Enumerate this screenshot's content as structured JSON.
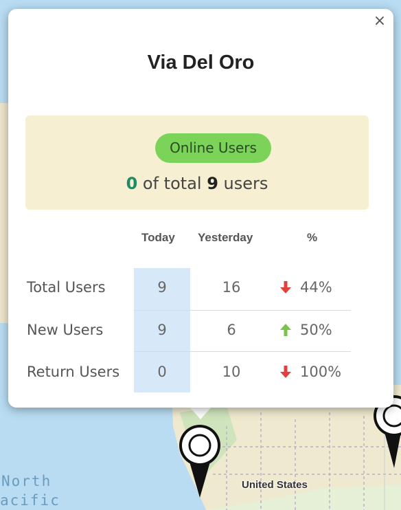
{
  "location": {
    "title": "Via Del Oro"
  },
  "popup": {
    "close_label": "×"
  },
  "online": {
    "badge_label": "Online Users",
    "online_count": "0",
    "of_text": "of total",
    "total_count": "9",
    "users_text": "users"
  },
  "table": {
    "headers": {
      "today": "Today",
      "yesterday": "Yesterday",
      "percent": "%"
    },
    "rows": [
      {
        "label": "Total Users",
        "today": "9",
        "yesterday": "16",
        "trend": "down",
        "percent": "44%"
      },
      {
        "label": "New Users",
        "today": "9",
        "yesterday": "6",
        "trend": "up",
        "percent": "50%"
      },
      {
        "label": "Return Users",
        "today": "0",
        "yesterday": "10",
        "trend": "down",
        "percent": "100%"
      }
    ]
  },
  "map": {
    "ocean_label_line1": "North",
    "ocean_label_line2": "acific",
    "country_label": "United States"
  },
  "colors": {
    "online_badge": "#7bd35a",
    "online_count": "#1f8a64",
    "trend_down": "#e0413c",
    "trend_up": "#7bc24a",
    "today_highlight": "#d7e8f8",
    "summary_box": "#f7efd2"
  },
  "icons": {
    "down": "arrow-down-icon",
    "up": "arrow-up-icon",
    "marker": "map-pin-icon"
  }
}
